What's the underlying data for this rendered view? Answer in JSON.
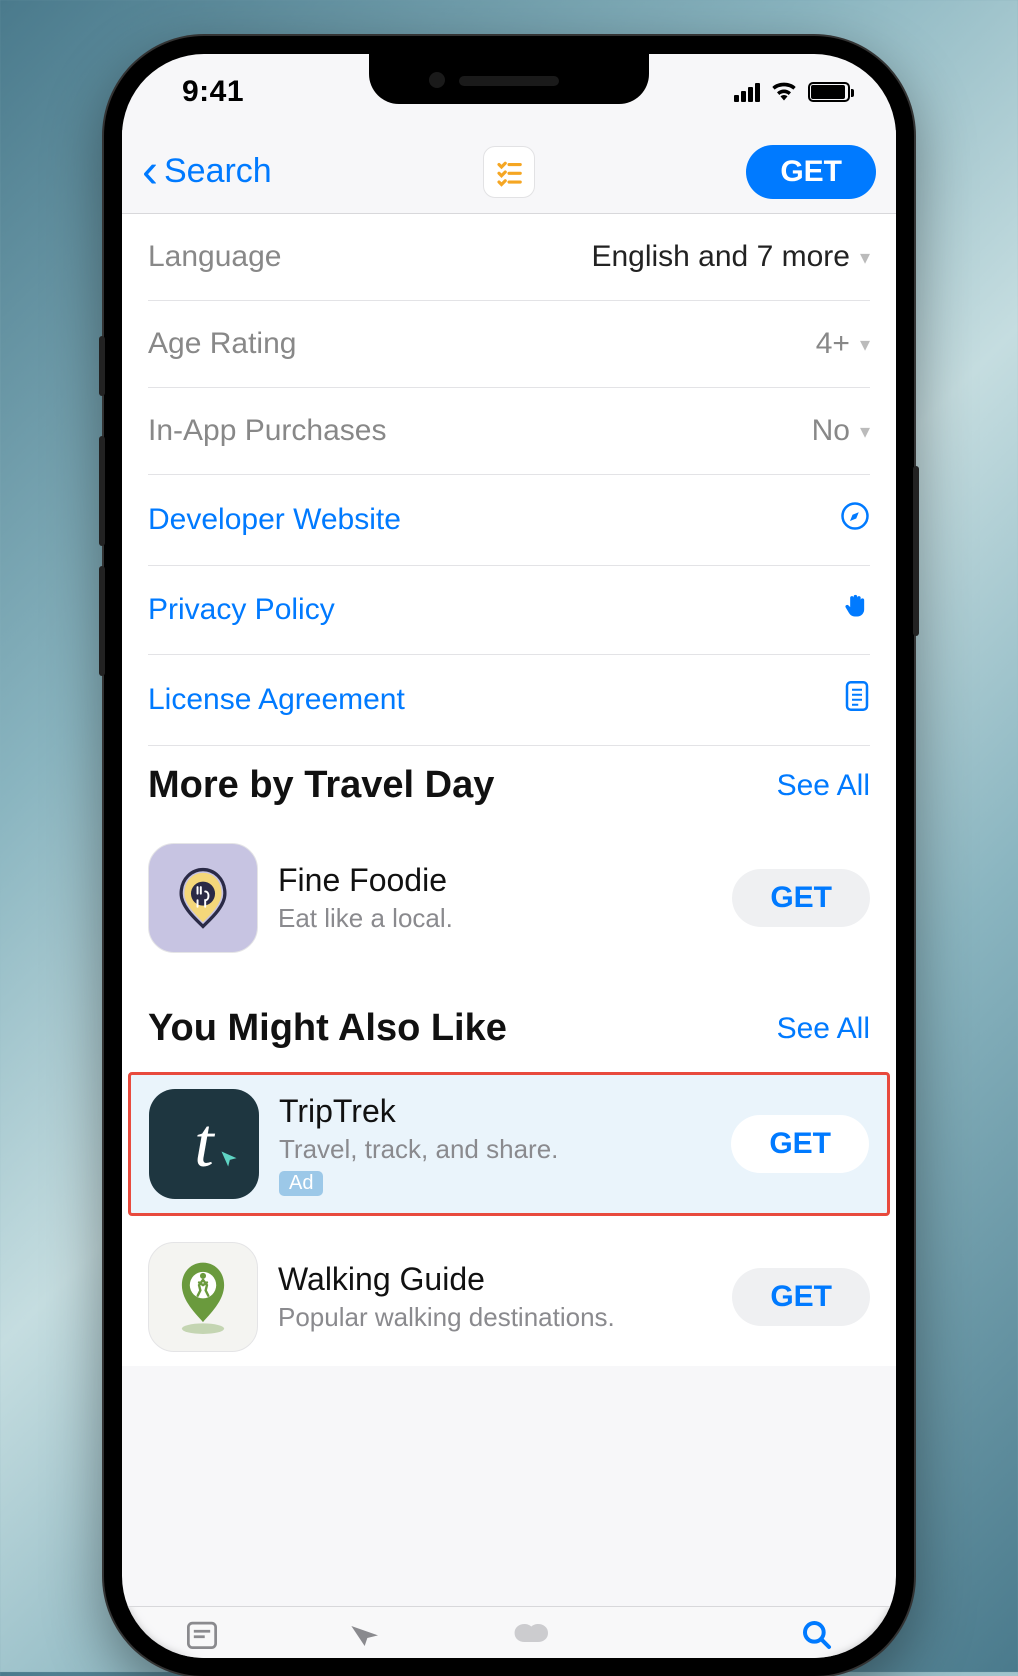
{
  "status": {
    "time": "9:41"
  },
  "nav": {
    "back_label": "Search",
    "get_label": "GET"
  },
  "info_rows": [
    {
      "label": "Language",
      "value": "English and 7 more",
      "hasChevron": true
    },
    {
      "label": "Age Rating",
      "value": "4+",
      "hasChevron": true
    },
    {
      "label": "In-App Purchases",
      "value": "No",
      "hasChevron": true
    }
  ],
  "link_rows": [
    {
      "label": "Developer Website",
      "icon": "compass"
    },
    {
      "label": "Privacy Policy",
      "icon": "hand"
    },
    {
      "label": "License Agreement",
      "icon": "document"
    }
  ],
  "sections": {
    "more_by": {
      "title": "More by Travel Day",
      "see_all": "See All",
      "apps": [
        {
          "name": "Fine Foodie",
          "desc": "Eat like a local.",
          "get": "GET",
          "icon": "foodie"
        }
      ]
    },
    "you_might": {
      "title": "You Might Also Like",
      "see_all": "See All",
      "apps": [
        {
          "name": "TripTrek",
          "desc": "Travel, track, and share.",
          "get": "GET",
          "icon": "triptrek",
          "ad": "Ad",
          "highlighted": true
        },
        {
          "name": "Walking Guide",
          "desc": "Popular walking destinations.",
          "get": "GET",
          "icon": "walking"
        }
      ]
    }
  }
}
